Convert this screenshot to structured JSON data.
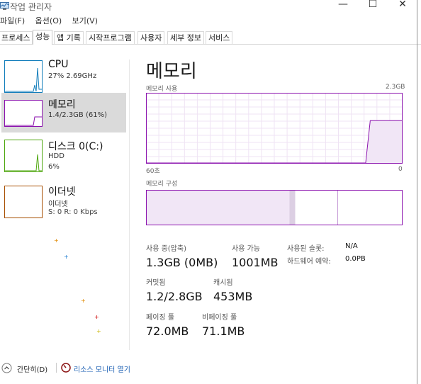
{
  "window": {
    "title": "작업 관리자",
    "minimize": "—",
    "maximize": "☐",
    "close": "✕"
  },
  "menu": [
    "파일(F)",
    "옵션(O)",
    "보기(V)"
  ],
  "tabs": [
    "프로세스",
    "성능",
    "앱 기록",
    "시작프로그램",
    "사용자",
    "세부 정보",
    "서비스"
  ],
  "active_tab": "성능",
  "sidebar": [
    {
      "title": "CPU",
      "sub1": "27% 2.69GHz",
      "sub2": "",
      "sub3": "",
      "color": "#117dbb"
    },
    {
      "title": "메모리",
      "sub1": "1.4/2.3GB (61%)",
      "sub2": "",
      "sub3": "",
      "color": "#8b12ae"
    },
    {
      "title": "디스크 0(C:)",
      "sub1": "HDD",
      "sub2": "6%",
      "sub3": "",
      "color": "#4da60c"
    },
    {
      "title": "이더넷",
      "sub1": "이더넷",
      "sub2": "S: 0 R: 0 Kbps",
      "sub3": "",
      "color": "#a74f01"
    }
  ],
  "main": {
    "title": "메모리",
    "usage_label": "메모리 사용",
    "usage_max": "2.3GB",
    "time_left": "60초",
    "time_right": "0",
    "composition_label": "메모리 구성",
    "usage_history": [
      0,
      0,
      0,
      0,
      0,
      0,
      0,
      0,
      0,
      0,
      0,
      0,
      0,
      0,
      0,
      0,
      0,
      0,
      0,
      0,
      0,
      0,
      0,
      0,
      0,
      0,
      0,
      0,
      0,
      0,
      0,
      0,
      0,
      0,
      0,
      0,
      0,
      0,
      0,
      0,
      0,
      0,
      0,
      0,
      0,
      0,
      0,
      0,
      0,
      0.61,
      0.61,
      0.61,
      0.61,
      0.61,
      0.61,
      0.61,
      0.61
    ],
    "stats": {
      "in_use_label": "사용 중(압축)",
      "in_use": "1.3GB (0MB)",
      "available_label": "사용 가능",
      "available": "1001MB",
      "slots_label": "사용된 슬롯:",
      "slots": "N/A",
      "hw_reserved_label": "하드웨어 예약:",
      "hw_reserved": "0.0PB",
      "committed_label": "커밋됨",
      "committed": "1.2/2.8GB",
      "cached_label": "캐시됨",
      "cached": "453MB",
      "paged_label": "페이징 풀",
      "paged": "72.0MB",
      "nonpaged_label": "비페이징 풀",
      "nonpaged": "71.1MB"
    }
  },
  "footer": {
    "brief": "간단히(D)",
    "resmon": "리소스 모니터 열기"
  }
}
